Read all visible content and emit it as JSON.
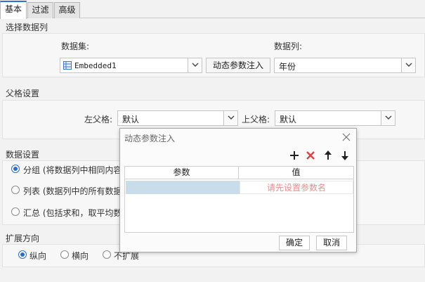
{
  "tabs": [
    {
      "label": "基本",
      "active": true
    },
    {
      "label": "过滤",
      "active": false
    },
    {
      "label": "高级",
      "active": false
    }
  ],
  "select_data_column": {
    "title": "选择数据列",
    "dataset_label": "数据集:",
    "dataset_value": "Embedded1",
    "dynamic_param_button": "动态参数注入",
    "column_label": "数据列:",
    "column_value": "年份"
  },
  "parent_settings": {
    "title": "父格设置",
    "left_parent_label": "左父格:",
    "left_parent_value": "默认",
    "top_parent_label": "上父格:",
    "top_parent_value": "默认"
  },
  "data_settings": {
    "title": "数据设置",
    "options": [
      {
        "label": "分组 (将数据列中相同内容的",
        "checked": true
      },
      {
        "label": "列表 (数据列中的所有数据",
        "checked": false
      },
      {
        "label": "汇总 (包括求和，取平均数",
        "checked": false
      }
    ]
  },
  "expand_direction": {
    "title": "扩展方向",
    "options": [
      {
        "label": "纵向",
        "checked": true
      },
      {
        "label": "横向",
        "checked": false
      },
      {
        "label": "不扩展",
        "checked": false
      }
    ]
  },
  "dialog": {
    "title": "动态参数注入",
    "columns": [
      "参数",
      "值"
    ],
    "placeholder": "请先设置参数名",
    "ok_button": "确定",
    "cancel_button": "取消"
  },
  "colors": {
    "accent": "#2f74d0",
    "delete_icon": "#e04040",
    "placeholder_text": "#ef8b8b",
    "selected_cell": "#c9dce9"
  },
  "icons": [
    "dataset-icon",
    "chevron-down-icon",
    "close-icon",
    "add-icon",
    "delete-icon",
    "arrow-up-icon",
    "arrow-down-icon"
  ]
}
